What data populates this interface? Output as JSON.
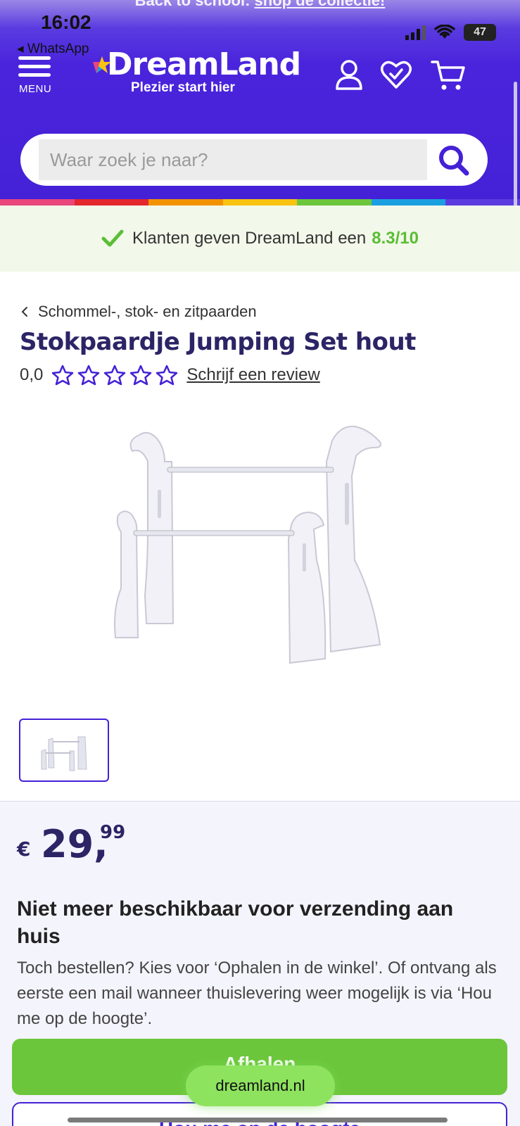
{
  "status": {
    "time": "16:02",
    "back_app": "◂ WhatsApp",
    "battery": "47"
  },
  "promo": {
    "text": "Back to school: ",
    "link": "shop de collectie!"
  },
  "header": {
    "menu_label": "MENU",
    "logo_word": "DreamLand",
    "logo_tagline": "Plezier start hier",
    "icons": [
      "account-icon",
      "heart-icon",
      "cart-icon"
    ]
  },
  "search": {
    "placeholder": "Waar zoek je naar?"
  },
  "trust": {
    "text": "Klanten geven DreamLand een",
    "score": "8.3/10"
  },
  "breadcrumb": {
    "label": "Schommel-, stok- en zitpaarden"
  },
  "product": {
    "title": "Stokpaardje Jumping Set hout",
    "rating": "0,0",
    "stars_filled": 0,
    "stars_total": 5,
    "review_link": "Schrijf een review"
  },
  "price": {
    "currency": "€",
    "euros": "29,",
    "cents": "99"
  },
  "availability": {
    "title": "Niet meer beschikbaar voor verzending aan huis",
    "text": "Toch bestellen? Kies voor ‘Ophalen in de winkel’. Of ontvang als eerste een mail wanneer thuislevering weer mogelijk is via ‘Hou me op de hoogte’."
  },
  "buttons": {
    "pickup": "Afhalen",
    "notify": "Hou me op de hoogte"
  },
  "browser": {
    "url": "dreamland.nl"
  },
  "colors": {
    "brand_purple": "#4421d6",
    "title_navy": "#2b2465",
    "accent_green": "#6cc63c",
    "rainbow": [
      "#e8467c",
      "#e4262d",
      "#f39200",
      "#f9c311",
      "#6cc63c",
      "#1aa0e0",
      "#5b3be0"
    ]
  }
}
